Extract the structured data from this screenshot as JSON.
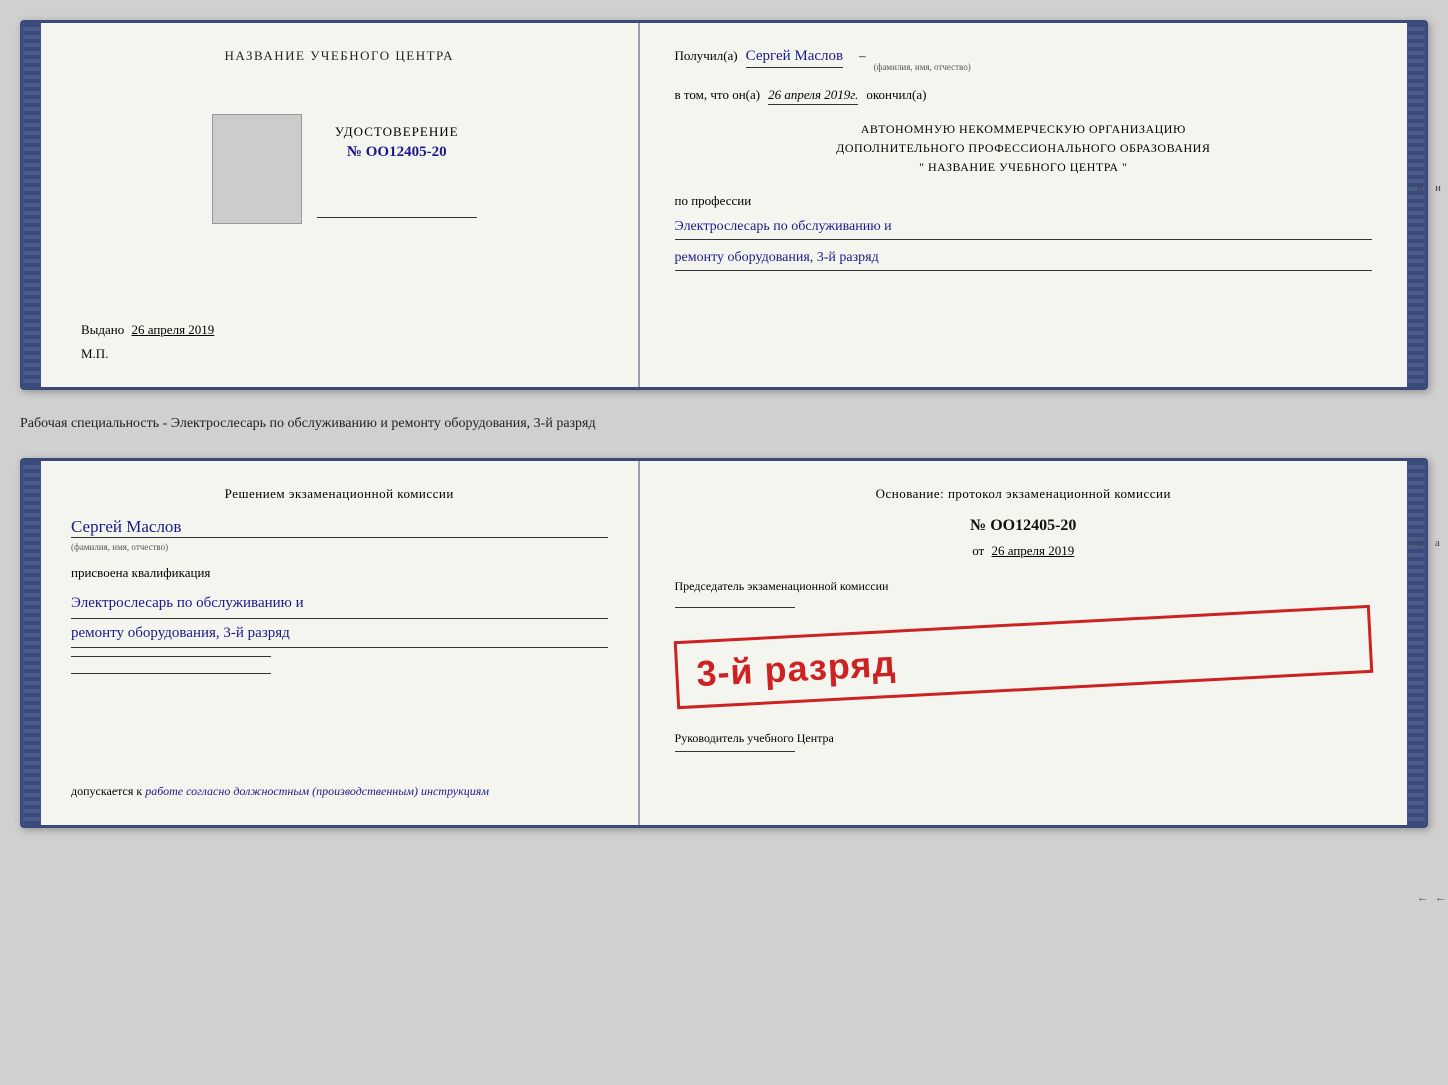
{
  "top_cert": {
    "left": {
      "title": "НАЗВАНИЕ УЧЕБНОГО ЦЕНТРА",
      "udostoverenie_label": "УДОСТОВЕРЕНИЕ",
      "number": "№ OO12405-20",
      "vydano_label": "Выдано",
      "vydano_date": "26 апреля 2019",
      "mp_label": "М.П."
    },
    "right": {
      "poluchil_label": "Получил(а)",
      "poluchil_name": "Сергей Маслов",
      "fio_subtitle": "(фамилия, имя, отчество)",
      "vtom_label": "в том, что он(а)",
      "vtom_date": "26 апреля 2019г.",
      "okonchil_label": "окончил(а)",
      "org_line1": "АВТОНОМНУЮ НЕКОММЕРЧЕСКУЮ ОРГАНИЗАЦИЮ",
      "org_line2": "ДОПОЛНИТЕЛЬНОГО ПРОФЕССИОНАЛЬНОГО ОБРАЗОВАНИЯ",
      "org_line3": "\"    НАЗВАНИЕ УЧЕБНОГО ЦЕНТРА    \"",
      "po_professii_label": "по профессии",
      "profession_line1": "Электрослесарь по обслуживанию и",
      "profession_line2": "ремонту оборудования, 3-й разряд"
    }
  },
  "separator": {
    "text": "Рабочая специальность - Электрослесарь по обслуживанию и ремонту оборудования, 3-й разряд"
  },
  "bottom_cert": {
    "left": {
      "resheniem_title": "Решением экзаменационной комиссии",
      "name": "Сергей Маслов",
      "fio_subtitle": "(фамилия, имя, отчество)",
      "prisvoena_label": "присвоена квалификация",
      "qual_line1": "Электрослесарь по обслуживанию и",
      "qual_line2": "ремонту оборудования, 3-й разряд",
      "dopuskaetsya_label": "допускается к",
      "dopuskaetsya_text": "работе согласно должностным (производственным) инструкциям"
    },
    "right": {
      "osnovanie_title": "Основание: протокол экзаменационной комиссии",
      "number": "№ OO12405-20",
      "ot_label": "от",
      "ot_date": "26 апреля 2019",
      "predsedatel_label": "Председатель экзаменационной комиссии",
      "stamp_text": "3-й разряд",
      "rukovoditel_label": "Руководитель учебного Центра"
    }
  }
}
